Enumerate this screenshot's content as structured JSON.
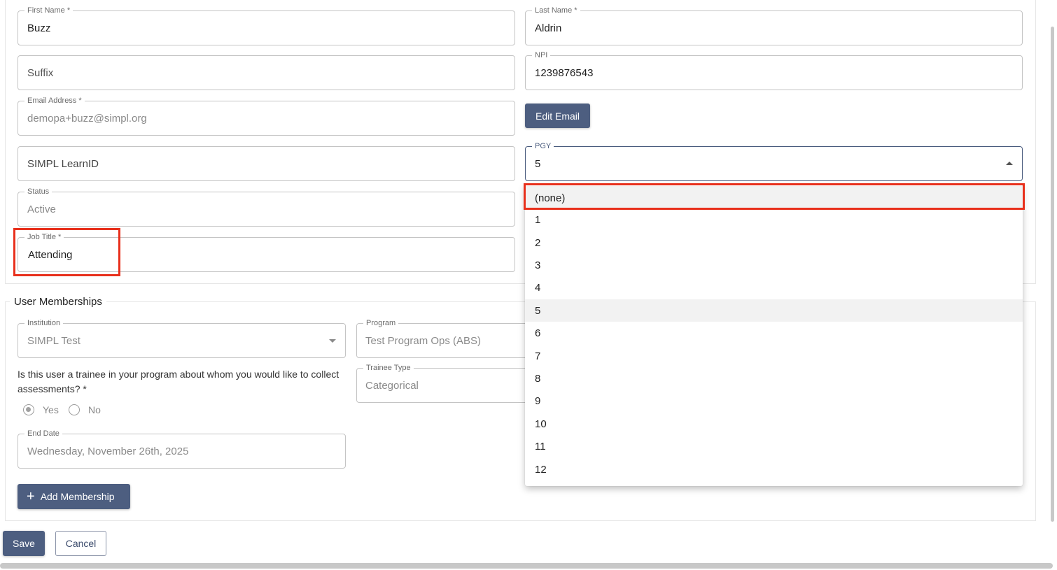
{
  "profile": {
    "first_name": {
      "label": "First Name *",
      "value": "Buzz"
    },
    "last_name": {
      "label": "Last Name *",
      "value": "Aldrin"
    },
    "suffix": {
      "placeholder": "Suffix"
    },
    "npi": {
      "label": "NPI",
      "value": "1239876543"
    },
    "email": {
      "label": "Email Address *",
      "value": "demopa+buzz@simpl.org"
    },
    "edit_email_button": "Edit Email",
    "learn_id": {
      "placeholder": "SIMPL LearnID"
    },
    "pgy": {
      "label": "PGY",
      "value": "5"
    },
    "status": {
      "label": "Status",
      "value": "Active"
    },
    "job_title": {
      "label": "Job Title *",
      "value": "Attending"
    }
  },
  "pgy_menu": {
    "options": [
      "(none)",
      "1",
      "2",
      "3",
      "4",
      "5",
      "6",
      "7",
      "8",
      "9",
      "10",
      "11",
      "12"
    ],
    "selected": "5",
    "highlighted": "(none)"
  },
  "memberships": {
    "section_title": "User Memberships",
    "institution": {
      "label": "Institution",
      "value": "SIMPL Test"
    },
    "program": {
      "label": "Program",
      "value": "Test Program Ops (ABS)"
    },
    "trainee_question": "Is this user a trainee in your program about whom you would like to collect assessments? *",
    "trainee_type": {
      "label": "Trainee Type",
      "value": "Categorical"
    },
    "yes_label": "Yes",
    "no_label": "No",
    "selected_option": "Yes",
    "end_date": {
      "label": "End Date",
      "value": "Wednesday, November 26th, 2025"
    },
    "add_membership_button": "Add Membership"
  },
  "actions": {
    "save": "Save",
    "cancel": "Cancel"
  },
  "colors": {
    "primary_button": "#4d5e80",
    "highlight_box": "#e8301c"
  },
  "icons": [
    "chevron-down-icon",
    "chevron-up-icon",
    "plus-icon"
  ]
}
